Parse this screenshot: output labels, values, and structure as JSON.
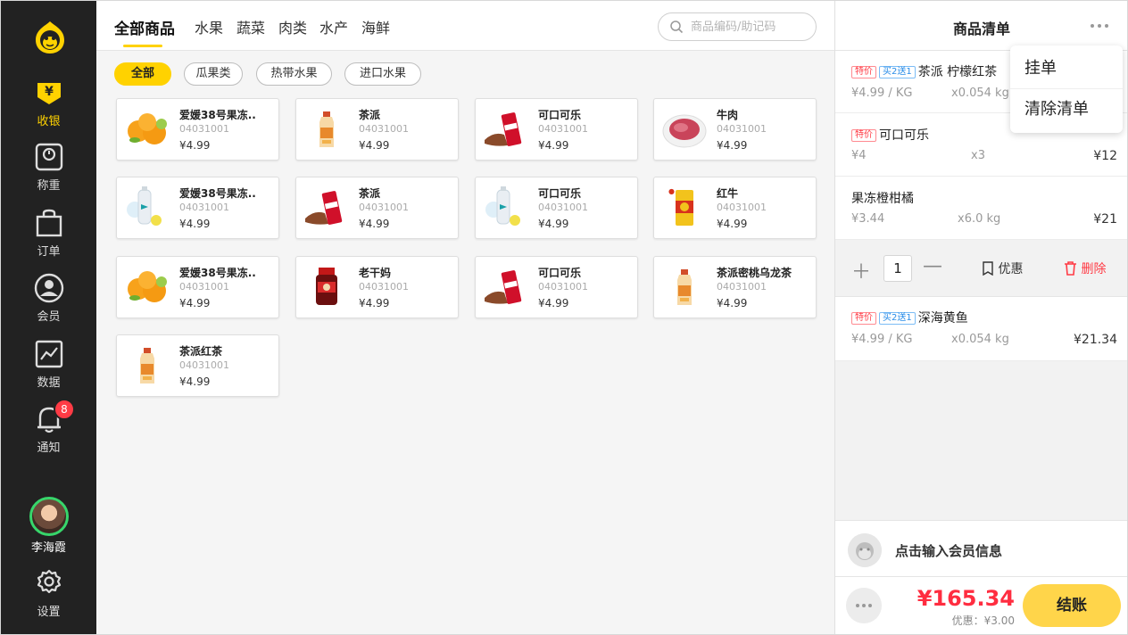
{
  "sidebar": {
    "items": [
      {
        "label": "收银",
        "icon": "cashier-icon",
        "active": true
      },
      {
        "label": "称重",
        "icon": "scale-icon"
      },
      {
        "label": "订单",
        "icon": "bag-icon"
      },
      {
        "label": "会员",
        "icon": "user-icon"
      },
      {
        "label": "数据",
        "icon": "chart-icon"
      },
      {
        "label": "通知",
        "icon": "bell-icon",
        "badge": "8"
      }
    ],
    "user_name": "李海霞",
    "settings_label": "设置",
    "accent": "#ffd200"
  },
  "main": {
    "tabs": [
      "全部商品",
      "水果",
      "蔬菜",
      "肉类",
      "水产",
      "海鲜"
    ],
    "search_placeholder": "商品编码/助记码",
    "chips": [
      "全部",
      "瓜果类",
      "热带水果",
      "进口水果"
    ],
    "products": [
      {
        "name": "爱媛38号果冻..",
        "code": "04031001",
        "price": "¥4.99",
        "img": "orange"
      },
      {
        "name": "茶派",
        "code": "04031001",
        "price": "¥4.99",
        "img": "tea"
      },
      {
        "name": "可口可乐",
        "code": "04031001",
        "price": "¥4.99",
        "img": "cola"
      },
      {
        "name": "牛肉",
        "code": "04031001",
        "price": "¥4.99",
        "img": "meat"
      },
      {
        "name": "爱媛38号果冻..",
        "code": "04031001",
        "price": "¥4.99",
        "img": "water"
      },
      {
        "name": "茶派",
        "code": "04031001",
        "price": "¥4.99",
        "img": "cola"
      },
      {
        "name": "可口可乐",
        "code": "04031001",
        "price": "¥4.99",
        "img": "water"
      },
      {
        "name": "红牛",
        "code": "04031001",
        "price": "¥4.99",
        "img": "redbull"
      },
      {
        "name": "爱媛38号果冻..",
        "code": "04031001",
        "price": "¥4.99",
        "img": "orange"
      },
      {
        "name": "老干妈",
        "code": "04031001",
        "price": "¥4.99",
        "img": "sauce"
      },
      {
        "name": "可口可乐",
        "code": "04031001",
        "price": "¥4.99",
        "img": "cola"
      },
      {
        "name": "茶派密桃乌龙茶",
        "code": "04031001",
        "price": "¥4.99",
        "img": "tea"
      },
      {
        "name": "茶派红茶",
        "code": "04031001",
        "price": "¥4.99",
        "img": "tea"
      }
    ]
  },
  "cart": {
    "title": "商品清单",
    "items": [
      {
        "tags": [
          "特价",
          "买2送1"
        ],
        "name": "茶派 柠檬红茶",
        "unit_price": "¥4.99 / KG",
        "qty": "x0.054 kg",
        "total": ""
      },
      {
        "tags": [
          "特价"
        ],
        "name": "可口可乐",
        "unit_price": "¥4",
        "qty": "x3",
        "total": "¥12"
      },
      {
        "tags": [],
        "name": "果冻橙柑橘",
        "unit_price": "¥3.44",
        "qty": "x6.0 kg",
        "total": "¥21"
      },
      {
        "tags": [
          "特价",
          "买2送1"
        ],
        "name": "深海黄鱼",
        "unit_price": "¥4.99 / KG",
        "qty": "x0.054 kg",
        "total": "¥21.34"
      }
    ],
    "qty_value": "1",
    "discount_label": "优惠",
    "delete_label": "删除",
    "dropdown": [
      "挂单",
      "清除清单"
    ],
    "member_prompt": "点击输入会员信息",
    "total": "¥165.34",
    "discount": "优惠：¥3.00",
    "checkout_label": "结账"
  }
}
